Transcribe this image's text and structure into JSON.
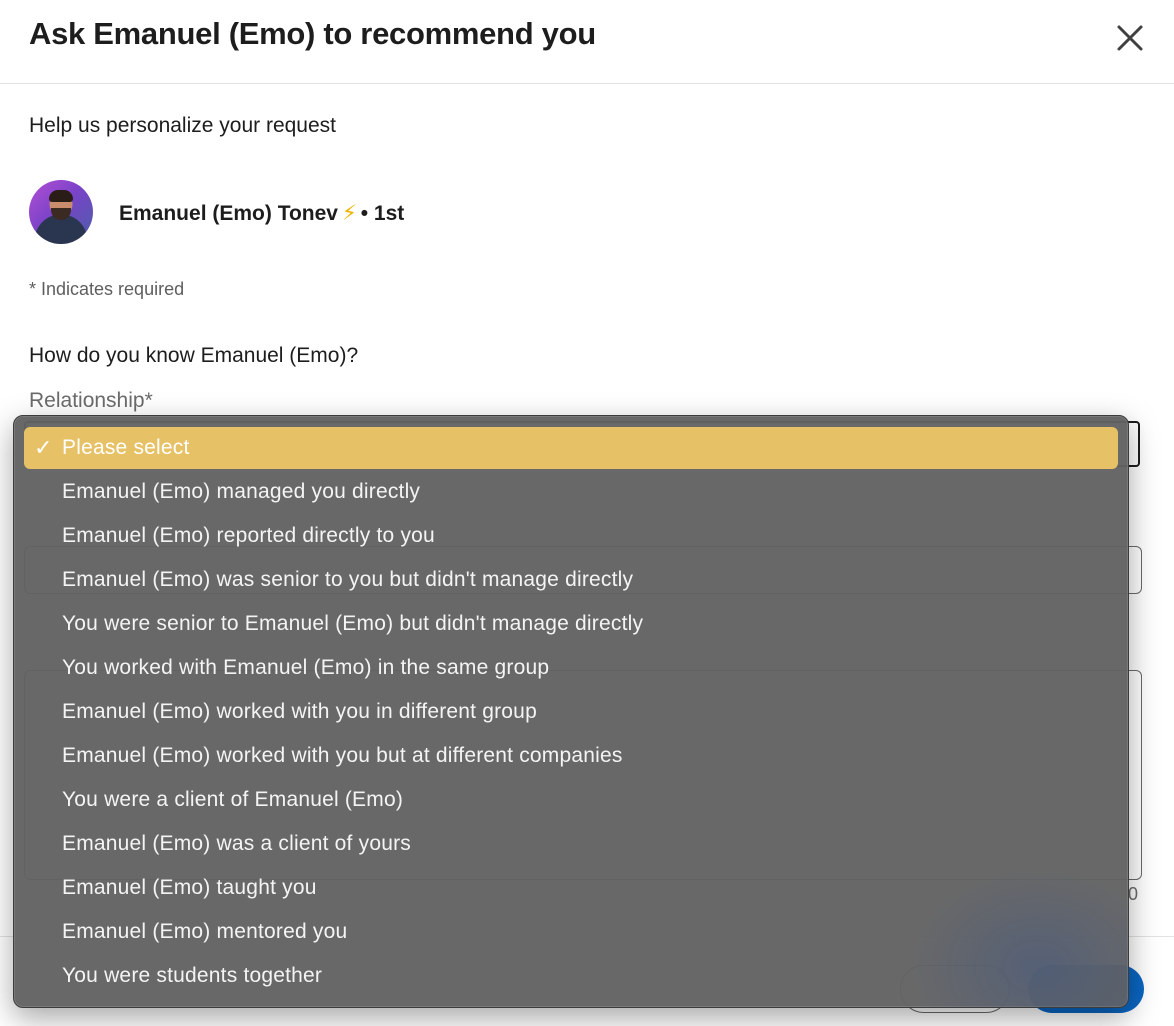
{
  "modal": {
    "title": "Ask Emanuel (Emo) to recommend you",
    "subtitle": "Help us personalize your request",
    "close_icon": "close-icon"
  },
  "person": {
    "name": "Emanuel (Emo) Tonev",
    "badge_icon": "lightning-bolt-icon",
    "badge_glyph": "⚡",
    "degree": "• 1st"
  },
  "form": {
    "required_note": "* Indicates required",
    "question": "How do you know Emanuel (Emo)?",
    "relationship_label": "Relationship*",
    "char_count_fragment": "0"
  },
  "dropdown": {
    "check_glyph": "✓",
    "options": [
      {
        "label": "Please select",
        "selected": true
      },
      {
        "label": "Emanuel (Emo) managed you directly",
        "selected": false
      },
      {
        "label": "Emanuel (Emo) reported directly to you",
        "selected": false
      },
      {
        "label": "Emanuel (Emo) was senior to you but didn't manage directly",
        "selected": false
      },
      {
        "label": "You were senior to Emanuel (Emo) but didn't manage directly",
        "selected": false
      },
      {
        "label": "You worked with Emanuel (Emo) in the same group",
        "selected": false
      },
      {
        "label": "Emanuel (Emo) worked with you in different group",
        "selected": false
      },
      {
        "label": "Emanuel (Emo) worked with you but at different companies",
        "selected": false
      },
      {
        "label": "You were a client of Emanuel (Emo)",
        "selected": false
      },
      {
        "label": "Emanuel (Emo) was a client of yours",
        "selected": false
      },
      {
        "label": "Emanuel (Emo) taught you",
        "selected": false
      },
      {
        "label": "Emanuel (Emo) mentored you",
        "selected": false
      },
      {
        "label": "You were students together",
        "selected": false
      }
    ]
  },
  "colors": {
    "selected_highlight": "#e6c165",
    "dropdown_bg": "#626262",
    "primary_button": "#0a66c2"
  }
}
